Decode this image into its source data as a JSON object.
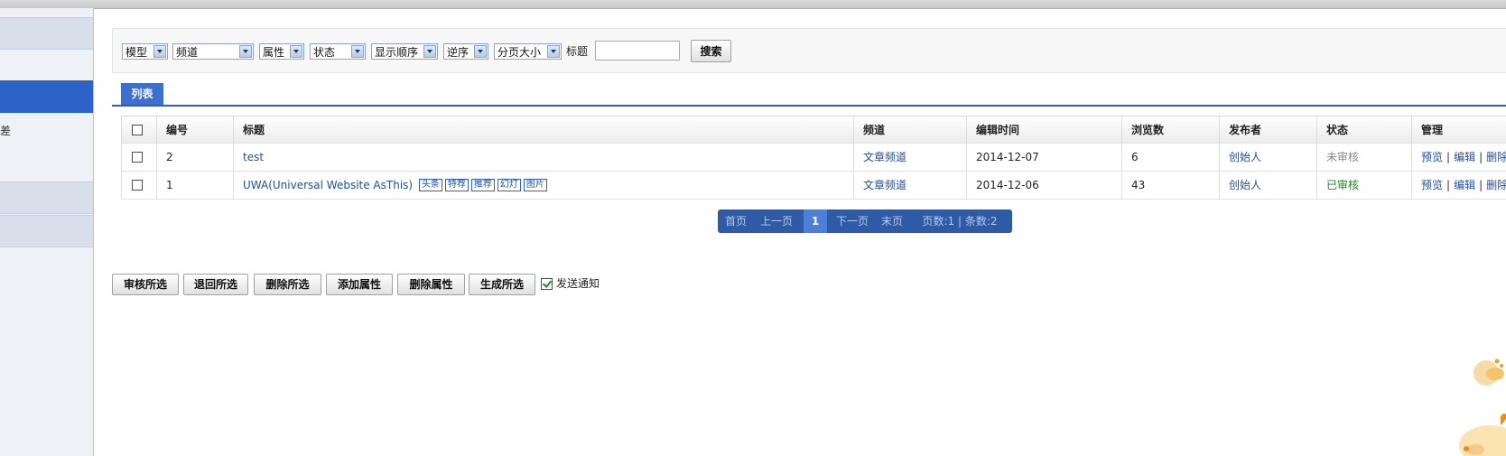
{
  "sidebar": {
    "partial_text": "差"
  },
  "filters": {
    "model": "模型",
    "channel": "频道",
    "attribute": "属性",
    "status": "状态",
    "display_order": "显示顺序",
    "order_direction": "逆序",
    "page_size": "分页大小",
    "title_label": "标题",
    "title_value": "",
    "search_button": "搜索"
  },
  "tab": {
    "label": "列表"
  },
  "table": {
    "headers": {
      "id": "编号",
      "title": "标题",
      "channel": "频道",
      "edit_time": "编辑时间",
      "views": "浏览数",
      "publisher": "发布者",
      "status": "状态",
      "manage": "管理"
    },
    "rows": [
      {
        "id": "2",
        "title": "test",
        "tags": [],
        "channel": "文章频道",
        "edit_time": "2014-12-07",
        "views": "6",
        "publisher": "创始人",
        "status": "未审核",
        "actions": {
          "preview": "预览",
          "edit": "编辑",
          "delete": "删除"
        }
      },
      {
        "id": "1",
        "title": "UWA(Universal Website AsThis)",
        "tags": [
          "头条",
          "特荐",
          "推荐",
          "幻灯",
          "图片"
        ],
        "channel": "文章频道",
        "edit_time": "2014-12-06",
        "views": "43",
        "publisher": "创始人",
        "status": "已审核",
        "actions": {
          "preview": "预览",
          "edit": "编辑",
          "delete": "删除"
        }
      }
    ],
    "separator": "|"
  },
  "pager": {
    "first": "首页",
    "prev": "上一页",
    "current": "1",
    "next": "下一页",
    "last": "末页",
    "summary": "页数:1 | 条数:2"
  },
  "actions": {
    "approve_selected": "审核所选",
    "return_selected": "退回所选",
    "delete_selected": "删除所选",
    "add_attribute": "添加属性",
    "delete_attribute": "删除属性",
    "generate_selected": "生成所选",
    "send_notify": "发送通知",
    "send_notify_checked": true
  },
  "colors": {
    "accent": "#2d63c8",
    "link": "#1f4fa8",
    "status_pending": "#888888",
    "status_approved": "#1a8a1a"
  }
}
